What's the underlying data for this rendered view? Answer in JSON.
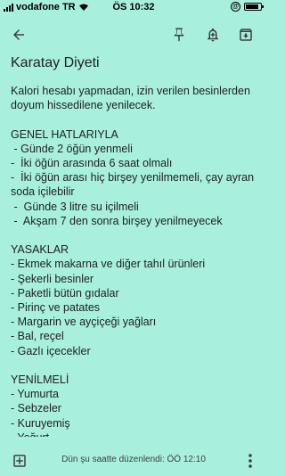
{
  "status_bar": {
    "carrier": "vodafone TR",
    "time": "ÖS 10:32",
    "battery_level": 0.85
  },
  "toolbar": {
    "icons": [
      "back-arrow-icon",
      "pin-icon",
      "reminder-bell-icon",
      "archive-icon"
    ]
  },
  "note": {
    "title": "Karatay Diyeti",
    "body": "Kalori hesabı yapmadan, izin verilen besinlerden doyum hissedilene yenilecek.\n\nGENEL HATLARIYLA\n - Günde 2 öğün yenmeli\n-  İki öğün arasında 6 saat olmalı\n-  İki öğün arası hiç birşey yenilmemeli, çay ayran soda içilebilir\n -  Günde 3 litre su içilmeli\n -  Akşam 7 den sonra birşey yenilmeyecek\n\nYASAKLAR\n- Ekmek makarna ve diğer tahıl ürünleri\n- Şekerli besinler\n- Paketli bütün gıdalar\n- Pirinç ve patates\n- Margarin ve ayçiçeği yağları\n- Bal, reçel\n- Gazlı içecekler\n\nYENİLMELİ\n- Yumurta\n- Sebzeler\n- Kuruyemiş\n- Yoğurt\n- Tavuk,et,balık"
  },
  "bottom_bar": {
    "edited_text": "Dün şu saatte düzenlendi: ÖÖ 12:10",
    "icons": [
      "add-box-icon",
      "more-vert-icon"
    ]
  },
  "colors": {
    "note_background": "#a8f0dd",
    "icon_color": "#3c4043"
  }
}
